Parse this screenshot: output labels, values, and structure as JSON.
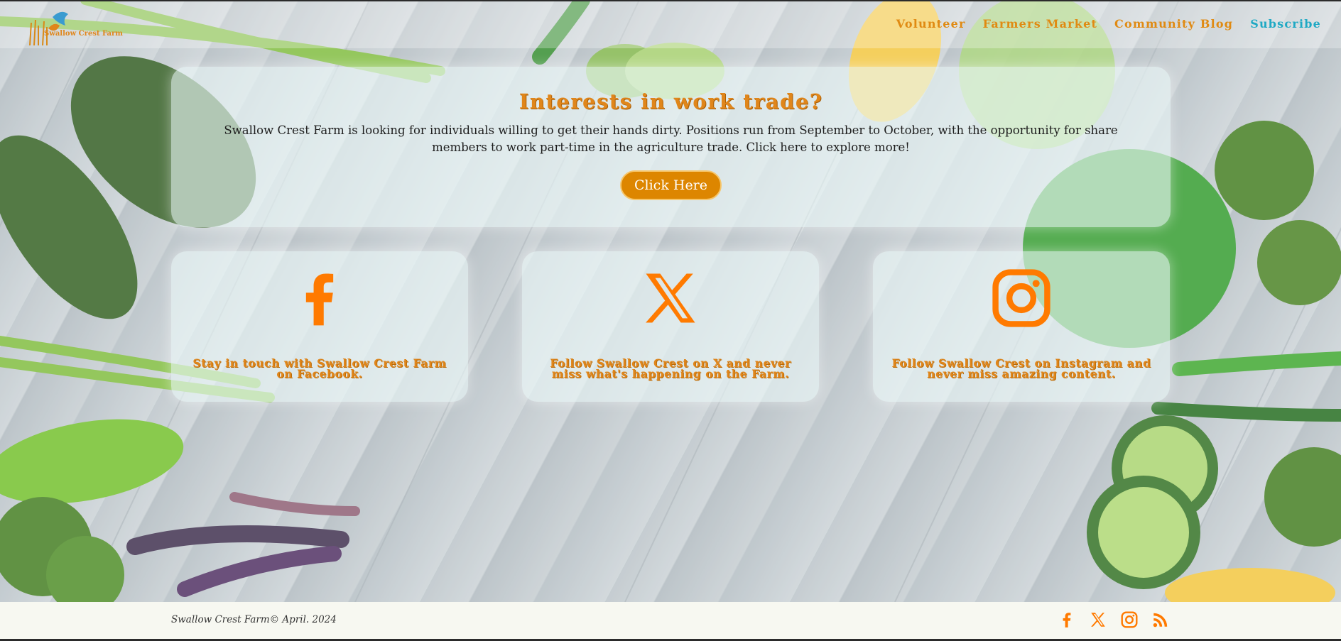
{
  "header": {
    "logo_text": "Swallow Crest Farm",
    "nav": [
      {
        "label": "Volunteer"
      },
      {
        "label": "Farmers Market"
      },
      {
        "label": "Community Blog"
      },
      {
        "label": "Subscribe"
      }
    ]
  },
  "hero": {
    "title": "Interests in work trade?",
    "text": "Swallow Crest Farm is looking for individuals willing to get their hands dirty. Positions run from September to October, with the opportunity for share members to work part-time in the agriculture trade. Click here to explore more!",
    "button_label": "Click Here"
  },
  "cards": [
    {
      "icon": "facebook-icon",
      "text": "Stay in touch with Swallow Crest Farm on Facebook."
    },
    {
      "icon": "x-icon",
      "text": "Follow Swallow Crest on X and never miss what's happening on the Farm."
    },
    {
      "icon": "instagram-icon",
      "text": "Follow Swallow Crest on Instagram and never miss amazing content."
    }
  ],
  "footer": {
    "copyright": "Swallow Crest Farm© April. 2024",
    "icons": [
      "facebook-icon",
      "x-icon",
      "instagram-icon",
      "rss-icon"
    ]
  },
  "colors": {
    "accent": "#e0861b",
    "button": "#dd8600",
    "subscribe": "#1fa9c4",
    "footer_bg": "#f7f8f1"
  }
}
